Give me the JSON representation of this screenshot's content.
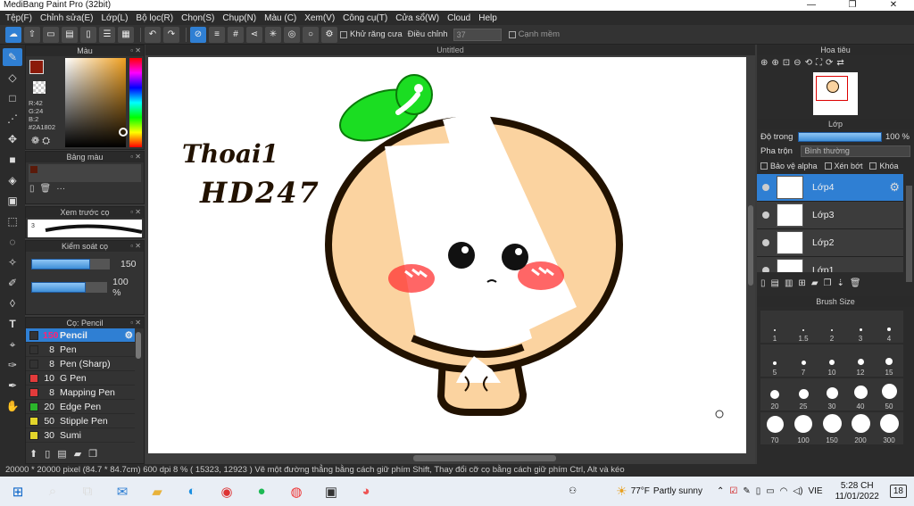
{
  "window": {
    "title": "MediBang Paint Pro (32bit)"
  },
  "menu": [
    "Tệp(F)",
    "Chỉnh sửa(E)",
    "Lớp(L)",
    "Bộ lọc(R)",
    "Chọn(S)",
    "Chụp(N)",
    "Màu (C)",
    "Xem(V)",
    "Công cụ(T)",
    "Cửa sổ(W)",
    "Cloud",
    "Help"
  ],
  "toolbar": {
    "antialias_label": "Khử răng cưa",
    "adjust_label": "Điều chỉnh",
    "adjust_value": "37",
    "edge_label": "Cạnh mềm"
  },
  "color_panel": {
    "title": "Màu",
    "r": "R:42",
    "g": "G:24",
    "b": "B:2",
    "hex": "#2A1802"
  },
  "palette_panel": {
    "title": "Bảng màu",
    "more": "···"
  },
  "preview_panel": {
    "title": "Xem trước cọ",
    "value": "3"
  },
  "brush_control": {
    "title": "Kiểm soát cọ",
    "size": "150",
    "opacity": "100 %",
    "size_fill": 0.75,
    "opacity_fill": 0.72
  },
  "brush_panel": {
    "title": "Cọ: Pencil",
    "items": [
      {
        "size": "150",
        "name": "Pencil",
        "color": "#333333",
        "selected": true
      },
      {
        "size": "8",
        "name": "Pen",
        "color": "#333333"
      },
      {
        "size": "8",
        "name": "Pen (Sharp)",
        "color": "#333333"
      },
      {
        "size": "10",
        "name": "G Pen",
        "color": "#e33b3b"
      },
      {
        "size": "8",
        "name": "Mapping Pen",
        "color": "#e33b3b"
      },
      {
        "size": "20",
        "name": "Edge Pen",
        "color": "#2bb52b"
      },
      {
        "size": "50",
        "name": "Stipple Pen",
        "color": "#e3d52b"
      },
      {
        "size": "30",
        "name": "Sumi",
        "color": "#e3d52b"
      }
    ]
  },
  "canvas": {
    "title": "Untitled",
    "handwriting_line1": "Thoai1",
    "handwriting_line2": "HD247"
  },
  "navigator": {
    "title": "Hoa tiêu"
  },
  "layer_panel": {
    "title": "Lớp",
    "opacity_label": "Độ trong",
    "opacity_value": "100 %",
    "blend_label": "Pha trộn",
    "blend_value": "Bình thường",
    "protect_alpha": "Bảo vệ alpha",
    "clip": "Xén bớt",
    "lock": "Khóa",
    "layers": [
      {
        "name": "Lớp4",
        "selected": true
      },
      {
        "name": "Lớp3"
      },
      {
        "name": "Lớp2"
      },
      {
        "name": "Lớp1"
      }
    ]
  },
  "brush_size_panel": {
    "title": "Brush Size",
    "sizes": [
      "1",
      "1.5",
      "2",
      "3",
      "4",
      "5",
      "7",
      "10",
      "12",
      "15",
      "20",
      "25",
      "30",
      "40",
      "50",
      "70",
      "100",
      "150",
      "200",
      "300"
    ]
  },
  "status": {
    "text": "20000 * 20000 pixel   (84.7 * 84.7cm)   600 dpi   8 %   ( 15323, 12923 )   Vẽ một đường thẳng bằng cách giữ phím Shift, Thay đổi cỡ cọ bằng cách giữ phím Ctrl, Alt và kéo"
  },
  "taskbar": {
    "weather_temp": "77°F",
    "weather_text": "Partly sunny",
    "lang": "VIE",
    "time": "5:28 CH",
    "date": "11/01/2022",
    "notif": "18"
  }
}
